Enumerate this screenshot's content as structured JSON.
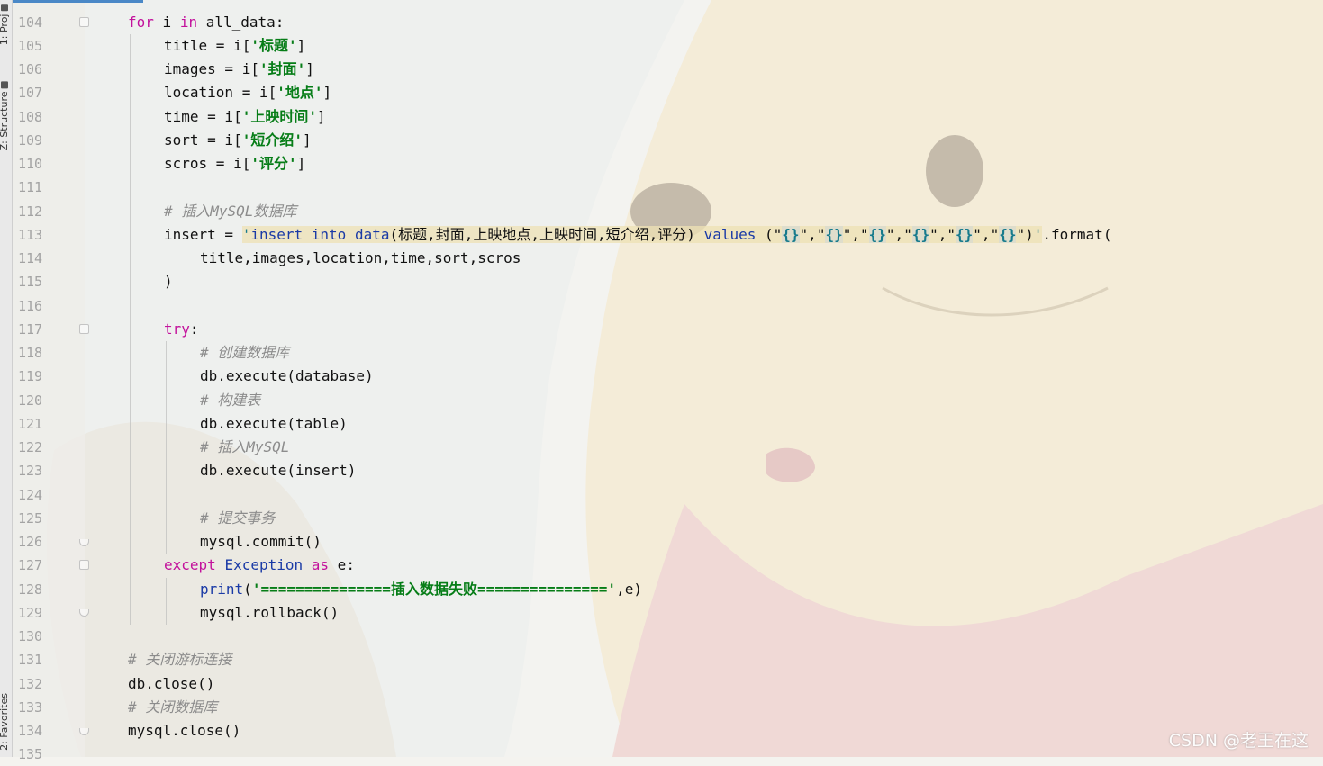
{
  "tool_windows": {
    "project_tab": "1: Proj",
    "structure_tab": "Z: Structure",
    "favorites_tab": "2: Favorites"
  },
  "lines": [
    {
      "num": "104",
      "text": "for i in all_data:"
    },
    {
      "num": "105",
      "text": "title = i['标题']"
    },
    {
      "num": "106",
      "text": "images = i['封面']"
    },
    {
      "num": "107",
      "text": "location = i['地点']"
    },
    {
      "num": "108",
      "text": "time = i['上映时间']"
    },
    {
      "num": "109",
      "text": "sort = i['短介绍']"
    },
    {
      "num": "110",
      "text": "scros = i['评分']"
    },
    {
      "num": "111",
      "text": ""
    },
    {
      "num": "112",
      "text": "# 插入MySQL数据库"
    },
    {
      "num": "113",
      "text": "insert = 'insert into data(标题,封面,上映地点,上映时间,短介绍,评分) values (\"{}\",\"{}\",\"{}\",\"{}\",\"{}\",\"{}\")'.format("
    },
    {
      "num": "114",
      "text": "title,images,location,time,sort,scros"
    },
    {
      "num": "115",
      "text": ")"
    },
    {
      "num": "116",
      "text": ""
    },
    {
      "num": "117",
      "text": "try:"
    },
    {
      "num": "118",
      "text": "# 创建数据库"
    },
    {
      "num": "119",
      "text": "db.execute(database)"
    },
    {
      "num": "120",
      "text": "# 构建表"
    },
    {
      "num": "121",
      "text": "db.execute(table)"
    },
    {
      "num": "122",
      "text": "# 插入MySQL"
    },
    {
      "num": "123",
      "text": "db.execute(insert)"
    },
    {
      "num": "124",
      "text": ""
    },
    {
      "num": "125",
      "text": "# 提交事务"
    },
    {
      "num": "126",
      "text": "mysql.commit()"
    },
    {
      "num": "127",
      "text": "except Exception as e:"
    },
    {
      "num": "128",
      "text": "print('===============插入数据失败===============',e)"
    },
    {
      "num": "129",
      "text": "mysql.rollback()"
    },
    {
      "num": "130",
      "text": ""
    },
    {
      "num": "131",
      "text": "# 关闭游标连接"
    },
    {
      "num": "132",
      "text": "db.close()"
    },
    {
      "num": "133",
      "text": "# 关闭数据库"
    },
    {
      "num": "134",
      "text": "mysql.close()"
    },
    {
      "num": "135",
      "text": ""
    }
  ],
  "tokens": {
    "for": "for",
    "in": "in",
    "try": "try",
    "except": "except",
    "Exception": "Exception",
    "as": "as",
    "print": "print",
    "format": ".format(",
    "k_biaoti": "'标题'",
    "k_fengmian": "'封面'",
    "k_didian": "'地点'",
    "k_shangying": "'上映时间'",
    "k_duanjieshao": "'短介绍'",
    "k_pingfen": "'评分'",
    "sql_open": "'",
    "sql_insert": "insert into",
    "sql_data": "data",
    "sql_columns": "(标题,封面,上映地点,上映时间,短介绍,评分) ",
    "sql_values": "values",
    "sql_paren_open": " (",
    "sql_quote": "\"",
    "sql_brace": "{}",
    "sql_comma": ",",
    "sql_paren_close": ")",
    "sql_close": "'",
    "print_str": "'===============插入数据失败==============='"
  },
  "comments": {
    "c112": "# 插入MySQL数据库",
    "c118": "# 创建数据库",
    "c120": "# 构建表",
    "c122": "# 插入MySQL",
    "c125": "# 提交事务",
    "c131": "# 关闭游标连接",
    "c133": "# 关闭数据库"
  },
  "colors": {
    "keyword": "#c3129c",
    "builtin": "#1a3aa6",
    "string": "#067d17",
    "comment": "#8c8c8c",
    "line_number": "#a3a3a3",
    "active_tab_bar": "#4a88c7"
  },
  "watermark": "CSDN @老王在这"
}
